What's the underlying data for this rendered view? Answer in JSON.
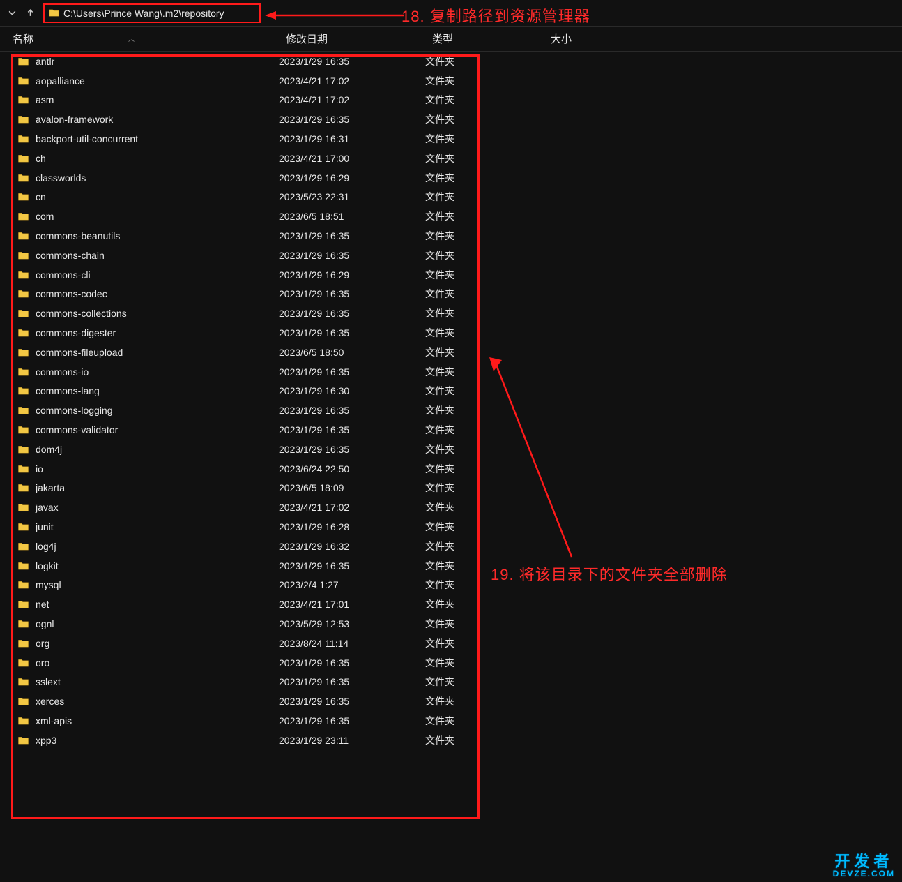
{
  "toolbar": {
    "path": "C:\\Users\\Prince Wang\\.m2\\repository"
  },
  "annotations": {
    "a18": "18. 复制路径到资源管理器",
    "a19": "19. 将该目录下的文件夹全部删除"
  },
  "headers": {
    "name": "名称",
    "modified": "修改日期",
    "type": "类型",
    "size": "大小"
  },
  "type_label": "文件夹",
  "files": [
    {
      "name": "antlr",
      "date": "2023/1/29 16:35"
    },
    {
      "name": "aopalliance",
      "date": "2023/4/21 17:02"
    },
    {
      "name": "asm",
      "date": "2023/4/21 17:02"
    },
    {
      "name": "avalon-framework",
      "date": "2023/1/29 16:35"
    },
    {
      "name": "backport-util-concurrent",
      "date": "2023/1/29 16:31"
    },
    {
      "name": "ch",
      "date": "2023/4/21 17:00"
    },
    {
      "name": "classworlds",
      "date": "2023/1/29 16:29"
    },
    {
      "name": "cn",
      "date": "2023/5/23 22:31"
    },
    {
      "name": "com",
      "date": "2023/6/5 18:51"
    },
    {
      "name": "commons-beanutils",
      "date": "2023/1/29 16:35"
    },
    {
      "name": "commons-chain",
      "date": "2023/1/29 16:35"
    },
    {
      "name": "commons-cli",
      "date": "2023/1/29 16:29"
    },
    {
      "name": "commons-codec",
      "date": "2023/1/29 16:35"
    },
    {
      "name": "commons-collections",
      "date": "2023/1/29 16:35"
    },
    {
      "name": "commons-digester",
      "date": "2023/1/29 16:35"
    },
    {
      "name": "commons-fileupload",
      "date": "2023/6/5 18:50"
    },
    {
      "name": "commons-io",
      "date": "2023/1/29 16:35"
    },
    {
      "name": "commons-lang",
      "date": "2023/1/29 16:30"
    },
    {
      "name": "commons-logging",
      "date": "2023/1/29 16:35"
    },
    {
      "name": "commons-validator",
      "date": "2023/1/29 16:35"
    },
    {
      "name": "dom4j",
      "date": "2023/1/29 16:35"
    },
    {
      "name": "io",
      "date": "2023/6/24 22:50"
    },
    {
      "name": "jakarta",
      "date": "2023/6/5 18:09"
    },
    {
      "name": "javax",
      "date": "2023/4/21 17:02"
    },
    {
      "name": "junit",
      "date": "2023/1/29 16:28"
    },
    {
      "name": "log4j",
      "date": "2023/1/29 16:32"
    },
    {
      "name": "logkit",
      "date": "2023/1/29 16:35"
    },
    {
      "name": "mysql",
      "date": "2023/2/4 1:27"
    },
    {
      "name": "net",
      "date": "2023/4/21 17:01"
    },
    {
      "name": "ognl",
      "date": "2023/5/29 12:53"
    },
    {
      "name": "org",
      "date": "2023/8/24 11:14"
    },
    {
      "name": "oro",
      "date": "2023/1/29 16:35"
    },
    {
      "name": "sslext",
      "date": "2023/1/29 16:35"
    },
    {
      "name": "xerces",
      "date": "2023/1/29 16:35"
    },
    {
      "name": "xml-apis",
      "date": "2023/1/29 16:35"
    },
    {
      "name": "xpp3",
      "date": "2023/1/29 23:11"
    }
  ],
  "watermark": {
    "line1": "开发者",
    "line2": "DEVZE.COM"
  }
}
